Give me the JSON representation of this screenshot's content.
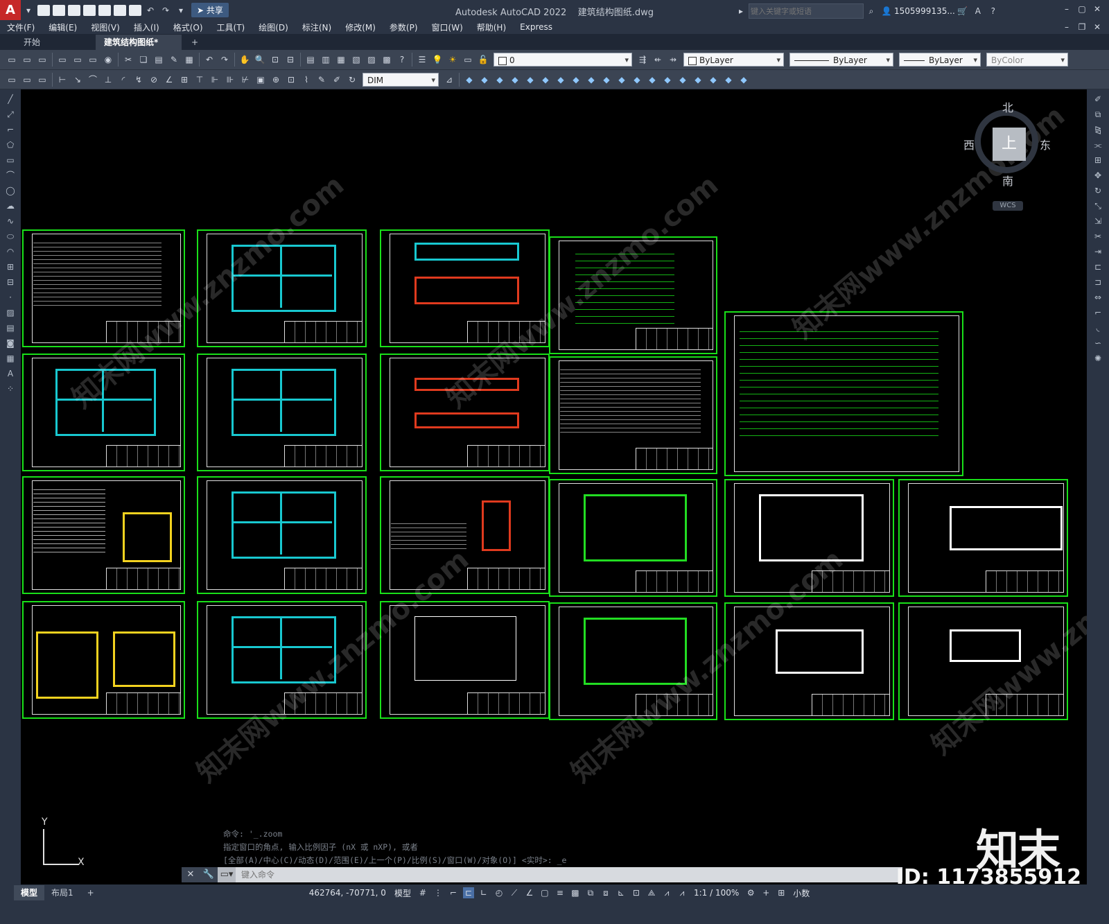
{
  "app": {
    "title": "Autodesk AutoCAD 2022",
    "file": "建筑结构图纸.dwg",
    "share": "共享",
    "search_placeholder": "键入关键字或短语",
    "user": "1505999135..."
  },
  "menu": [
    "文件(F)",
    "编辑(E)",
    "视图(V)",
    "插入(I)",
    "格式(O)",
    "工具(T)",
    "绘图(D)",
    "标注(N)",
    "修改(M)",
    "参数(P)",
    "窗口(W)",
    "帮助(H)",
    "Express"
  ],
  "tabs": {
    "start": "开始",
    "active": "建筑结构图纸*"
  },
  "toolbar": {
    "layer": "0",
    "color": "ByLayer",
    "linetype": "ByLayer",
    "lineweight": "ByLayer",
    "plotstyle": "ByColor",
    "dimstyle": "DIM"
  },
  "viewcube": {
    "north": "北",
    "south": "南",
    "east": "东",
    "west": "西",
    "top": "上",
    "wcs": "WCS"
  },
  "ucs": {
    "x": "X",
    "y": "Y"
  },
  "command": {
    "history": [
      "命令: '_.zoom",
      "指定窗口的角点, 输入比例因子 (nX 或 nXP), 或者",
      "[全部(A)/中心(C)/动态(D)/范围(E)/上一个(P)/比例(S)/窗口(W)/对象(O)] <实时>: _e"
    ],
    "placeholder": "键入命令"
  },
  "status": {
    "model_tab": "模型",
    "layout_tab": "布局1",
    "coords": "462764, -70771, 0",
    "space": "模型",
    "scale": "1:1 / 100%",
    "units": "小数"
  },
  "watermark": {
    "logo": "知末",
    "id": "ID: 1173855912",
    "site": "知末网www.znzmo.com"
  }
}
